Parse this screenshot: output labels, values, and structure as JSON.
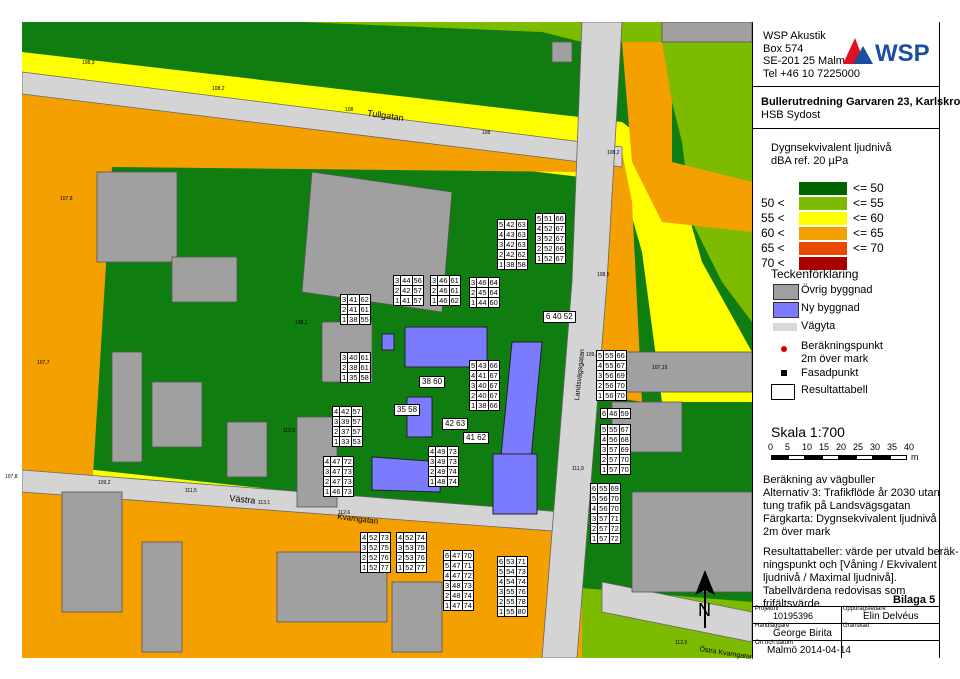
{
  "company": {
    "name": "WSP Akustik",
    "address1": "Box 574",
    "address2": "SE-201 25 Malmö",
    "phone": "Tel +46 10 7225000",
    "logo_text": "WSP"
  },
  "project": {
    "title": "Bullerutredning Garvaren 23, Karlskrona",
    "client": "HSB Sydost"
  },
  "legend": {
    "heading_line1": "Dygnsekvivalent ljudnivå",
    "heading_line2": "dBA ref. 20 µPa",
    "classes": [
      {
        "label": "",
        "upper": "<= 50",
        "color": "#006400"
      },
      {
        "label": "50 <",
        "upper": "<= 55",
        "color": "#7cbb00"
      },
      {
        "label": "55 <",
        "upper": "<= 60",
        "color": "#ffff00"
      },
      {
        "label": "60 <",
        "upper": "<= 65",
        "color": "#f4a000"
      },
      {
        "label": "65 <",
        "upper": "<= 70",
        "color": "#e84800"
      },
      {
        "label": "70 <",
        "upper": "",
        "color": "#a80000"
      }
    ],
    "signs_heading": "Teckenförklaring",
    "items": [
      {
        "label": "Övrig byggnad",
        "color": "#a0a0a0"
      },
      {
        "label": "Ny byggnad",
        "color": "#7b7bff"
      },
      {
        "label": "Vägyta",
        "color": "#d8d8d8"
      },
      {
        "label": "Beräkningspunkt",
        "label2": "2m över mark",
        "color": "#e00000"
      },
      {
        "label": "Fasadpunkt",
        "color": "#000000"
      },
      {
        "label": "Resultattabell",
        "color": "#ffffff"
      }
    ]
  },
  "scale": {
    "title": "Skala 1:700",
    "ticks": [
      "0",
      "5",
      "10",
      "15",
      "20",
      "25",
      "30",
      "35",
      "40"
    ],
    "unit": "m"
  },
  "calc_note": {
    "line1": "Beräkning av vägbuller",
    "line2": "Alternativ 3: Trafikflöde år 2030 utan",
    "line3": "tung trafik på Landsvägsgatan",
    "line4": "Färgkarta: Dygnsekvivalent ljudnivå",
    "line5": "2m över mark"
  },
  "result_note": {
    "line1": "Resultattabeller: värde per utvald beräk-",
    "line2": "ningspunkt och [Våning / Ekvivalent",
    "line3": "ljudnivå / Maximal ljudnivå].",
    "line4": "Tabellvärdena redovisas som",
    "line5": "frifältsvärde."
  },
  "appendix": "Bilaga 5",
  "titleblock": {
    "proj_label": "Projektnr",
    "proj_value": "10195396",
    "drawn_label": "Uppdragsledare",
    "drawn_value": "Elin Delvéus",
    "handler_label": "Handläggare",
    "handler_value": "George Birita",
    "checked_label": "Granskad",
    "checked_value": "",
    "place_label": "Ort och datum",
    "place_value": "Malmö 2014-04-14"
  },
  "map": {
    "streets": [
      "Tullgatan",
      "Västra",
      "Kvarngatan",
      "Landsvägsgatan",
      "Östra Kvarngatan"
    ],
    "heights": [
      "108,3",
      "108,2",
      "108",
      "108",
      "108,2",
      "107,8",
      "107,7",
      "108,1",
      "112,6",
      "109,2",
      "111,5",
      "113,1",
      "112,6",
      "109,5",
      "109,6",
      "107,19",
      "111,9",
      "112,9",
      "107,8",
      "108,5"
    ],
    "north": "N",
    "point_labels": [
      "38|60",
      "35|58",
      "42|63",
      "41|62",
      "6|40|52"
    ],
    "tables": [
      [
        "3|44|56",
        "2|42|57",
        "1|41|57"
      ],
      [
        "3|46|61",
        "2|46|61",
        "1|46|62"
      ],
      [
        "3|46|64",
        "2|45|64",
        "1|44|60"
      ],
      [
        "5|42|63",
        "4|43|63",
        "3|42|63",
        "2|42|62",
        "1|38|58"
      ],
      [
        "5|51|66",
        "4|52|67",
        "3|52|67",
        "2|52|66",
        "1|52|67"
      ],
      [
        "3|41|62",
        "2|41|61",
        "1|38|55"
      ],
      [
        "3|40|61",
        "2|38|61",
        "1|35|58"
      ],
      [
        "5|43|66",
        "4|41|67",
        "3|40|67",
        "2|40|67",
        "1|38|66"
      ],
      [
        "5|55|66",
        "4|55|67",
        "3|56|69",
        "2|56|70",
        "1|56|70"
      ],
      [
        "4|42|57",
        "3|39|57",
        "2|37|57",
        "1|33|53"
      ],
      [
        "6|46|59"
      ],
      [
        "5|55|67",
        "4|56|68",
        "3|57|69",
        "2|57|70",
        "1|57|70"
      ],
      [
        "4|49|73",
        "3|49|73",
        "2|49|74",
        "1|48|74"
      ],
      [
        "4|47|72",
        "3|47|73",
        "2|47|73",
        "1|46|73"
      ],
      [
        "6|55|69",
        "5|56|70",
        "4|56|70",
        "3|57|71",
        "2|57|72",
        "1|57|72"
      ],
      [
        "4|52|73",
        "3|52|75",
        "2|52|76",
        "1|52|77"
      ],
      [
        "4|52|74",
        "3|53|75",
        "2|53|76",
        "1|52|77"
      ],
      [
        "6|47|70",
        "5|47|71",
        "4|47|72",
        "3|48|73",
        "2|48|74",
        "1|47|74"
      ],
      [
        "6|53|71",
        "5|54|73",
        "4|54|74",
        "3|55|76",
        "2|55|78",
        "1|55|80"
      ]
    ]
  }
}
